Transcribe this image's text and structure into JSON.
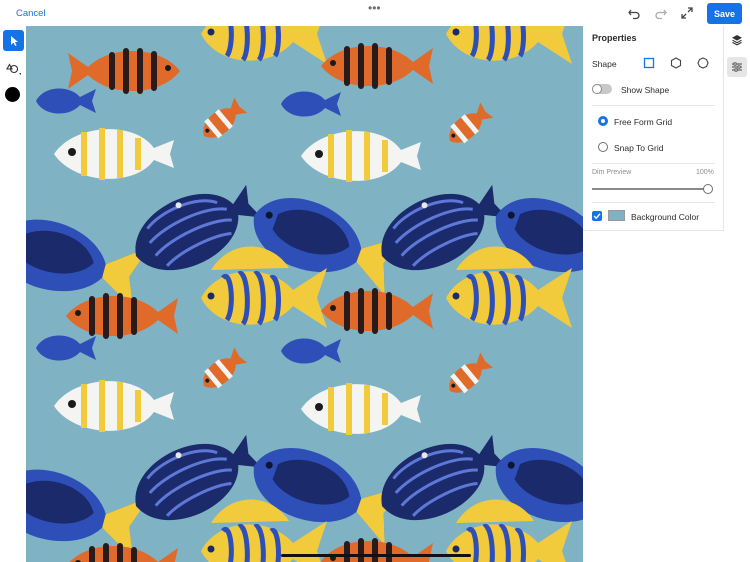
{
  "topbar": {
    "cancel_label": "Cancel",
    "save_label": "Save",
    "more_glyph": "•••",
    "icons": [
      "undo-icon",
      "redo-icon",
      "fullscreen-icon"
    ]
  },
  "tools": {
    "items": [
      "select-tool-icon",
      "shape-tool-icon",
      "color-picker-icon"
    ],
    "current_color": "#000000"
  },
  "properties": {
    "title": "Properties",
    "shape_label": "Shape",
    "shape_options": [
      "square-shape-icon",
      "hexagon-shape-icon",
      "circle-shape-icon"
    ],
    "selected_shape": "square",
    "show_shape_label": "Show Shape",
    "show_shape_on": false,
    "grid_options": [
      {
        "label": "Free Form Grid",
        "selected": true
      },
      {
        "label": "Snap To Grid",
        "selected": false
      }
    ],
    "dim_preview_label": "Dim Preview",
    "dim_preview_value": "100%",
    "dim_preview_level": 1.0,
    "background_color_label": "Background Color",
    "background_color_checked": true,
    "background_color": "#7fb3c4"
  },
  "side_icons": [
    "layers-icon",
    "sliders-icon"
  ],
  "colors": {
    "accent": "#1473e6",
    "canvas_bg": "#7fb3c4",
    "fish_orange": "#e06a2a",
    "fish_yellow": "#f2cb3c",
    "fish_blue": "#2e4fb8",
    "fish_navy": "#1b2a6b",
    "fish_white": "#f4f4f2"
  }
}
